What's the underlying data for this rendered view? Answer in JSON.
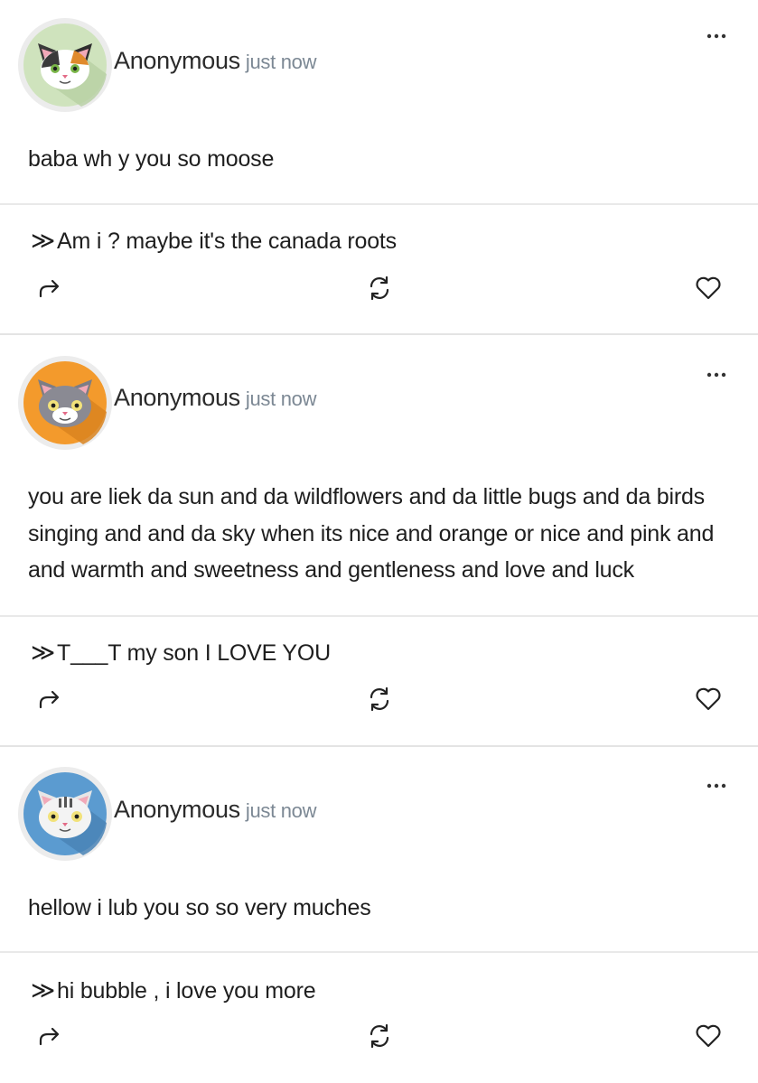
{
  "colors": {
    "text": "#1e1e1e",
    "timestamp": "#7c8894",
    "divider": "#e9e9e9",
    "avatar_green": "#cfe3bd",
    "avatar_orange": "#f39a2c",
    "avatar_blue": "#5b9bd0"
  },
  "posts": [
    {
      "author": "Anonymous",
      "time": "just now",
      "avatar_icon": "calico-cat-avatar",
      "question": "baba wh y you so moose",
      "answer_marker": "≫",
      "answer": "Am i ? maybe it's the canada roots",
      "menu_icon": "more-dots-icon",
      "share_icon": "share-arrow-icon",
      "refresh_icon": "refresh-icon",
      "like_icon": "heart-icon"
    },
    {
      "author": "Anonymous",
      "time": "just now",
      "avatar_icon": "gray-cat-avatar",
      "question": "you are liek da sun and da wildflowers and da little bugs and da birds singing and and da sky when its nice and orange or nice and pink and and warmth and sweetness and gentleness and love and luck",
      "answer_marker": "≫",
      "answer": "T___T my son I LOVE YOU",
      "menu_icon": "more-dots-icon",
      "share_icon": "share-arrow-icon",
      "refresh_icon": "refresh-icon",
      "like_icon": "heart-icon"
    },
    {
      "author": "Anonymous",
      "time": "just now",
      "avatar_icon": "tabby-cat-avatar",
      "question": "hellow i lub you so so very muches",
      "answer_marker": "≫",
      "answer": "hi bubble , i love you more",
      "menu_icon": "more-dots-icon",
      "share_icon": "share-arrow-icon",
      "refresh_icon": "refresh-icon",
      "like_icon": "heart-icon"
    }
  ]
}
